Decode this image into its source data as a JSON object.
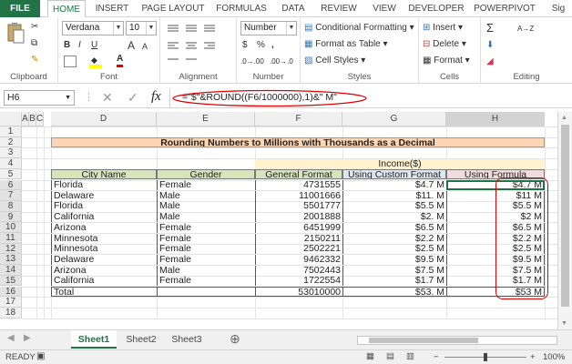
{
  "ribbon_tabs": [
    "FILE",
    "HOME",
    "INSERT",
    "PAGE LAYOUT",
    "FORMULAS",
    "DATA",
    "REVIEW",
    "VIEW",
    "DEVELOPER",
    "POWERPIVOT",
    "Sig"
  ],
  "clipboard": {
    "label": "Clipboard"
  },
  "font": {
    "name": "Verdana",
    "size": "10",
    "label": "Font",
    "bold": "B",
    "italic": "I",
    "underline": "U",
    "grow": "A",
    "shrink": "A",
    "font_color": "A"
  },
  "alignment": {
    "label": "Alignment"
  },
  "number": {
    "format": "Number",
    "currency": "$",
    "percent": "%",
    "comma": ",",
    "inc_decimal": ".0→.00",
    "dec_decimal": ".00→.0",
    "label": "Number"
  },
  "styles": {
    "conditional": "Conditional Formatting",
    "format_table": "Format as Table",
    "cell_styles": "Cell Styles",
    "label": "Styles"
  },
  "cells": {
    "insert": "Insert",
    "delete": "Delete",
    "format": "Format",
    "label": "Cells"
  },
  "editing": {
    "label": "Editing",
    "sum": "Σ",
    "sort": "A→Z"
  },
  "formula_bar": {
    "name_box": "H6",
    "formula": "=\"$\"&ROUND((F6/1000000),1)&\" M\"",
    "fx": "fx"
  },
  "columns": [
    "A",
    "B",
    "C",
    "D",
    "E",
    "F",
    "G",
    "H"
  ],
  "rows": [
    "1",
    "2",
    "3",
    "4",
    "5",
    "6",
    "7",
    "8",
    "9",
    "10",
    "11",
    "12",
    "13",
    "14",
    "15",
    "16",
    "17",
    "18"
  ],
  "sheet": {
    "title": "Rounding Numbers to Millions with Thousands as a Decimal",
    "income_header": "Income($)",
    "headers": [
      "City Name",
      "Gender",
      "General Format",
      "Using Custom Format",
      "Using Formula"
    ],
    "data": [
      [
        "Florida",
        "Female",
        "4731555",
        "$4.7 M",
        "$4.7 M"
      ],
      [
        "Delaware",
        "Male",
        "11001666",
        "$11. M",
        "$11 M"
      ],
      [
        "Florida",
        "Male",
        "5501777",
        "$5.5 M",
        "$5.5 M"
      ],
      [
        "California",
        "Male",
        "2001888",
        "$2. M",
        "$2 M"
      ],
      [
        "Arizona",
        "Female",
        "6451999",
        "$6.5 M",
        "$6.5 M"
      ],
      [
        "Minnesota",
        "Female",
        "2150211",
        "$2.2 M",
        "$2.2 M"
      ],
      [
        "Minnesota",
        "Female",
        "2502221",
        "$2.5 M",
        "$2.5 M"
      ],
      [
        "Delaware",
        "Female",
        "9462332",
        "$9.5 M",
        "$9.5 M"
      ],
      [
        "Arizona",
        "Male",
        "7502443",
        "$7.5 M",
        "$7.5 M"
      ],
      [
        "California",
        "Female",
        "1722554",
        "$1.7 M",
        "$1.7 M"
      ]
    ],
    "total": [
      "Total",
      "",
      "53010000",
      "$53. M",
      "$53 M"
    ]
  },
  "sheet_tabs": [
    "Sheet1",
    "Sheet2",
    "Sheet3"
  ],
  "add_sheet": "⊕",
  "status": {
    "ready": "READY",
    "zoom": "100%",
    "minus": "−",
    "plus": "+"
  },
  "colors": {
    "excel_green": "#217346",
    "title_fill": "#fcd5b4",
    "income_fill": "#fff2cc",
    "header_green": "#d8e4bc",
    "header_blue": "#dce6f1",
    "header_pink": "#f2dcdb",
    "red_annotation": "#e00000"
  }
}
